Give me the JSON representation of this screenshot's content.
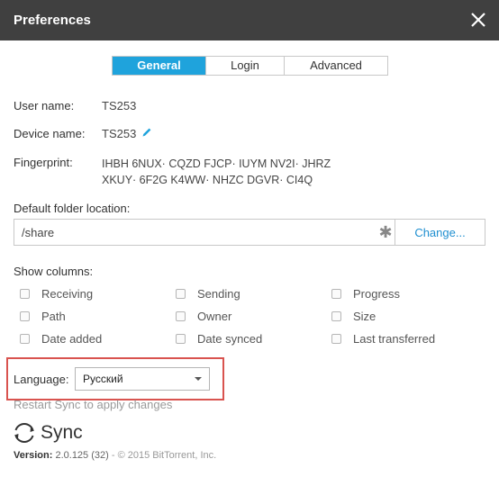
{
  "window": {
    "title": "Preferences"
  },
  "tabs": [
    "General",
    "Login",
    "Advanced"
  ],
  "user": {
    "name_label": "User name:",
    "name_value": "TS253"
  },
  "device": {
    "label": "Device name:",
    "value": "TS253"
  },
  "fingerprint": {
    "label": "Fingerprint:",
    "line1": "IHBH 6NUX· CQZD FJCP· IUYM NV2I· JHRZ",
    "line2": "XKUY· 6F2G K4WW· NHZC DGVR· CI4Q"
  },
  "folder": {
    "label": "Default folder location:",
    "value": "/share",
    "change_label": "Change..."
  },
  "columns": {
    "label": "Show columns:",
    "items": [
      "Receiving",
      "Sending",
      "Progress",
      "Path",
      "Owner",
      "Size",
      "Date added",
      "Date synced",
      "Last transferred"
    ]
  },
  "language": {
    "label": "Language:",
    "selected": "Русский"
  },
  "restart_text": "Restart Sync to apply changes",
  "logo": {
    "text": "Sync"
  },
  "version": {
    "label": "Version:",
    "value": "2.0.125 (32)",
    "copyright": "- © 2015 BitTorrent, Inc."
  },
  "colors": {
    "titlebar": "#404040",
    "accent": "#1fa3dc",
    "link": "#1f8fd0",
    "highlight": "#d9534f"
  }
}
